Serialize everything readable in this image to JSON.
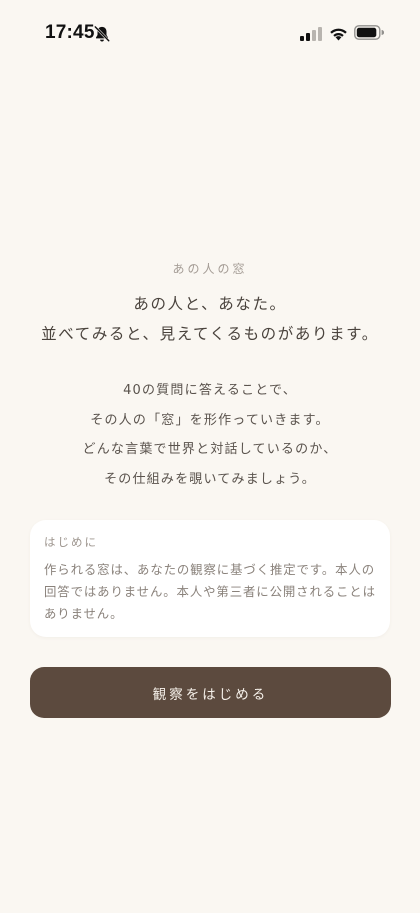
{
  "status_bar": {
    "time": "17:45",
    "icons": [
      "bell-slash-icon",
      "cellular-signal-icon",
      "wifi-icon",
      "battery-icon"
    ]
  },
  "intro": {
    "app_name": "あの人の窓",
    "headline": [
      "あの人と、あなた。",
      "並べてみると、見えてくるものがあります。"
    ],
    "description": [
      "40の質問に答えることで、",
      "その人の「窓」を形作っていきます。",
      "どんな言葉で世界と対話しているのか、",
      "その仕組みを覗いてみましょう。"
    ]
  },
  "notice": {
    "title": "はじめに",
    "body_lines": [
      "作られる窓は、あなたの観察に基づく推定です。本人の",
      "回答ではありません。本人や第三者に公開されることは",
      "ありません。"
    ]
  },
  "start_button": {
    "label": "観察をはじめる"
  },
  "colors": {
    "background": "#faf7f2",
    "card": "#ffffff",
    "button": "#5c4a3e",
    "button_text": "#f6f1ea",
    "text_primary": "#4a433d",
    "text_muted": "#a49c95"
  }
}
